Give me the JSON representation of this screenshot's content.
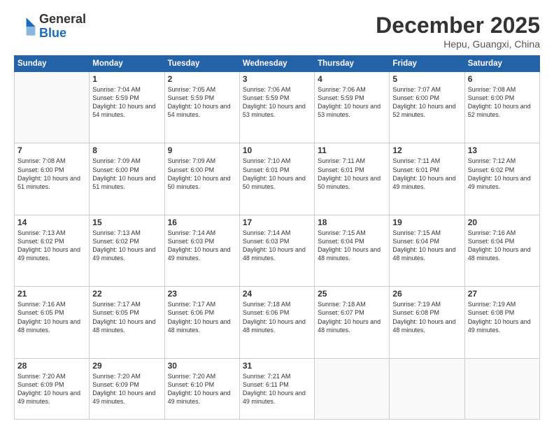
{
  "header": {
    "logo_general": "General",
    "logo_blue": "Blue",
    "month_title": "December 2025",
    "location": "Hepu, Guangxi, China"
  },
  "days_of_week": [
    "Sunday",
    "Monday",
    "Tuesday",
    "Wednesday",
    "Thursday",
    "Friday",
    "Saturday"
  ],
  "weeks": [
    [
      {
        "day": "",
        "empty": true
      },
      {
        "day": "1",
        "sunrise": "Sunrise: 7:04 AM",
        "sunset": "Sunset: 5:59 PM",
        "daylight": "Daylight: 10 hours and 54 minutes."
      },
      {
        "day": "2",
        "sunrise": "Sunrise: 7:05 AM",
        "sunset": "Sunset: 5:59 PM",
        "daylight": "Daylight: 10 hours and 54 minutes."
      },
      {
        "day": "3",
        "sunrise": "Sunrise: 7:06 AM",
        "sunset": "Sunset: 5:59 PM",
        "daylight": "Daylight: 10 hours and 53 minutes."
      },
      {
        "day": "4",
        "sunrise": "Sunrise: 7:06 AM",
        "sunset": "Sunset: 5:59 PM",
        "daylight": "Daylight: 10 hours and 53 minutes."
      },
      {
        "day": "5",
        "sunrise": "Sunrise: 7:07 AM",
        "sunset": "Sunset: 6:00 PM",
        "daylight": "Daylight: 10 hours and 52 minutes."
      },
      {
        "day": "6",
        "sunrise": "Sunrise: 7:08 AM",
        "sunset": "Sunset: 6:00 PM",
        "daylight": "Daylight: 10 hours and 52 minutes."
      }
    ],
    [
      {
        "day": "7",
        "sunrise": "Sunrise: 7:08 AM",
        "sunset": "Sunset: 6:00 PM",
        "daylight": "Daylight: 10 hours and 51 minutes."
      },
      {
        "day": "8",
        "sunrise": "Sunrise: 7:09 AM",
        "sunset": "Sunset: 6:00 PM",
        "daylight": "Daylight: 10 hours and 51 minutes."
      },
      {
        "day": "9",
        "sunrise": "Sunrise: 7:09 AM",
        "sunset": "Sunset: 6:00 PM",
        "daylight": "Daylight: 10 hours and 50 minutes."
      },
      {
        "day": "10",
        "sunrise": "Sunrise: 7:10 AM",
        "sunset": "Sunset: 6:01 PM",
        "daylight": "Daylight: 10 hours and 50 minutes."
      },
      {
        "day": "11",
        "sunrise": "Sunrise: 7:11 AM",
        "sunset": "Sunset: 6:01 PM",
        "daylight": "Daylight: 10 hours and 50 minutes."
      },
      {
        "day": "12",
        "sunrise": "Sunrise: 7:11 AM",
        "sunset": "Sunset: 6:01 PM",
        "daylight": "Daylight: 10 hours and 49 minutes."
      },
      {
        "day": "13",
        "sunrise": "Sunrise: 7:12 AM",
        "sunset": "Sunset: 6:02 PM",
        "daylight": "Daylight: 10 hours and 49 minutes."
      }
    ],
    [
      {
        "day": "14",
        "sunrise": "Sunrise: 7:13 AM",
        "sunset": "Sunset: 6:02 PM",
        "daylight": "Daylight: 10 hours and 49 minutes."
      },
      {
        "day": "15",
        "sunrise": "Sunrise: 7:13 AM",
        "sunset": "Sunset: 6:02 PM",
        "daylight": "Daylight: 10 hours and 49 minutes."
      },
      {
        "day": "16",
        "sunrise": "Sunrise: 7:14 AM",
        "sunset": "Sunset: 6:03 PM",
        "daylight": "Daylight: 10 hours and 49 minutes."
      },
      {
        "day": "17",
        "sunrise": "Sunrise: 7:14 AM",
        "sunset": "Sunset: 6:03 PM",
        "daylight": "Daylight: 10 hours and 48 minutes."
      },
      {
        "day": "18",
        "sunrise": "Sunrise: 7:15 AM",
        "sunset": "Sunset: 6:04 PM",
        "daylight": "Daylight: 10 hours and 48 minutes."
      },
      {
        "day": "19",
        "sunrise": "Sunrise: 7:15 AM",
        "sunset": "Sunset: 6:04 PM",
        "daylight": "Daylight: 10 hours and 48 minutes."
      },
      {
        "day": "20",
        "sunrise": "Sunrise: 7:16 AM",
        "sunset": "Sunset: 6:04 PM",
        "daylight": "Daylight: 10 hours and 48 minutes."
      }
    ],
    [
      {
        "day": "21",
        "sunrise": "Sunrise: 7:16 AM",
        "sunset": "Sunset: 6:05 PM",
        "daylight": "Daylight: 10 hours and 48 minutes."
      },
      {
        "day": "22",
        "sunrise": "Sunrise: 7:17 AM",
        "sunset": "Sunset: 6:05 PM",
        "daylight": "Daylight: 10 hours and 48 minutes."
      },
      {
        "day": "23",
        "sunrise": "Sunrise: 7:17 AM",
        "sunset": "Sunset: 6:06 PM",
        "daylight": "Daylight: 10 hours and 48 minutes."
      },
      {
        "day": "24",
        "sunrise": "Sunrise: 7:18 AM",
        "sunset": "Sunset: 6:06 PM",
        "daylight": "Daylight: 10 hours and 48 minutes."
      },
      {
        "day": "25",
        "sunrise": "Sunrise: 7:18 AM",
        "sunset": "Sunset: 6:07 PM",
        "daylight": "Daylight: 10 hours and 48 minutes."
      },
      {
        "day": "26",
        "sunrise": "Sunrise: 7:19 AM",
        "sunset": "Sunset: 6:08 PM",
        "daylight": "Daylight: 10 hours and 48 minutes."
      },
      {
        "day": "27",
        "sunrise": "Sunrise: 7:19 AM",
        "sunset": "Sunset: 6:08 PM",
        "daylight": "Daylight: 10 hours and 49 minutes."
      }
    ],
    [
      {
        "day": "28",
        "sunrise": "Sunrise: 7:20 AM",
        "sunset": "Sunset: 6:09 PM",
        "daylight": "Daylight: 10 hours and 49 minutes."
      },
      {
        "day": "29",
        "sunrise": "Sunrise: 7:20 AM",
        "sunset": "Sunset: 6:09 PM",
        "daylight": "Daylight: 10 hours and 49 minutes."
      },
      {
        "day": "30",
        "sunrise": "Sunrise: 7:20 AM",
        "sunset": "Sunset: 6:10 PM",
        "daylight": "Daylight: 10 hours and 49 minutes."
      },
      {
        "day": "31",
        "sunrise": "Sunrise: 7:21 AM",
        "sunset": "Sunset: 6:11 PM",
        "daylight": "Daylight: 10 hours and 49 minutes."
      },
      {
        "day": "",
        "empty": true
      },
      {
        "day": "",
        "empty": true
      },
      {
        "day": "",
        "empty": true
      }
    ]
  ]
}
